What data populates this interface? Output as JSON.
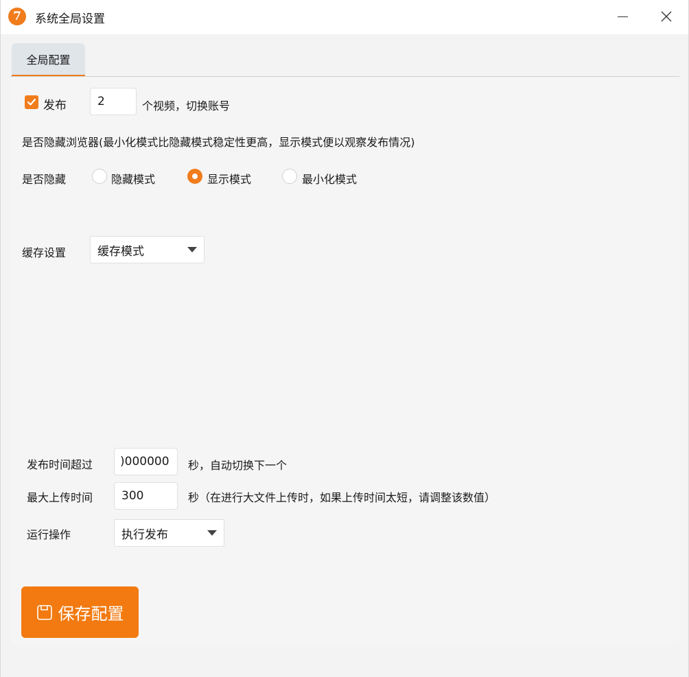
{
  "window": {
    "title": "系统全局设置",
    "app_icon_glyph": "7",
    "accent": "#f07c1c"
  },
  "tabs": [
    {
      "label": "全局配置",
      "active": true
    }
  ],
  "publish": {
    "checkbox_label": "发布",
    "checked": true,
    "count_value": "2",
    "suffix": "个视频，切换账号"
  },
  "browser_hide": {
    "description": "是否隐藏浏览器(最小化模式比隐藏模式稳定性更高，显示模式便以观察发布情况)",
    "label": "是否隐藏",
    "options": [
      {
        "label": "隐藏模式",
        "selected": false
      },
      {
        "label": "显示模式",
        "selected": true
      },
      {
        "label": "最小化模式",
        "selected": false
      }
    ]
  },
  "cache": {
    "label": "缓存设置",
    "selected": "缓存模式"
  },
  "timeout": {
    "label": "发布时间超过",
    "value": ")000000",
    "suffix": "秒，自动切换下一个"
  },
  "max_upload": {
    "label": "最大上传时间",
    "value": "300",
    "suffix": "秒（在进行大文件上传时，如果上传时间太短，请调整该数值）"
  },
  "run_action": {
    "label": "运行操作",
    "selected": "执行发布"
  },
  "save_button": {
    "label": "保存配置",
    "color": "#f27a10"
  }
}
